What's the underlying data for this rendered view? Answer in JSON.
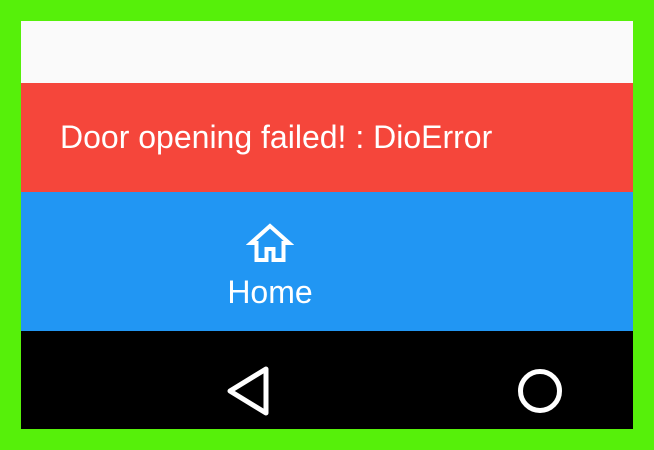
{
  "snackbar": {
    "message": "Door opening failed! : DioError"
  },
  "bottom_nav": {
    "items": [
      {
        "label": "Home",
        "icon": "home-icon",
        "selected": true
      }
    ]
  },
  "system_nav": {
    "buttons": [
      "back-icon",
      "circle-home-icon"
    ]
  },
  "colors": {
    "frame": "#56f00a",
    "appbar": "#fafafa",
    "snackbar": "#f5463b",
    "bottom_nav": "#2196f3",
    "system_nav": "#000000",
    "text": "#ffffff"
  }
}
